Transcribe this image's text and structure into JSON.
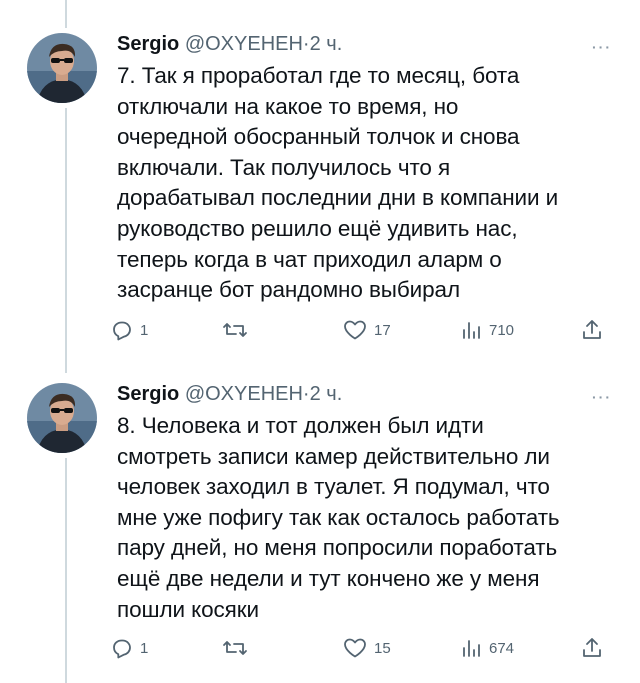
{
  "tweets": [
    {
      "author_name": "Sergio",
      "author_handle": "@OXYEHEH",
      "separator": "·",
      "time": "2 ч.",
      "more_glyph": "···",
      "text": "7. Так я проработал где то месяц, бота\nотключали на какое то время, но\nочередной обосранный толчок и снова\nвключали. Так получилось что я\nдорабатывал последнии дни в компании и\nруководство решило ещё удивить нас,\nтеперь когда в чат приходил аларм о\nзасранце бот рандомно выбирал",
      "replies": "1",
      "retweets": "",
      "likes": "17",
      "views": "710"
    },
    {
      "author_name": "Sergio",
      "author_handle": "@OXYEHEH",
      "separator": "·",
      "time": "2 ч.",
      "more_glyph": "···",
      "text": "8. Человека и тот должен был идти\nсмотреть записи камер действительно ли\nчеловек заходил в туалет. Я подумал, что\nмне уже пофигу так как осталось работать\nпару дней, но меня попросили поработать\nещё две недели и тут кончено же у меня\nпошли косяки",
      "replies": "1",
      "retweets": "",
      "likes": "15",
      "views": "674"
    }
  ],
  "icons": {
    "reply": "reply-icon",
    "retweet": "retweet-icon",
    "like": "heart-icon",
    "views": "views-icon",
    "share": "share-icon"
  },
  "colors": {
    "text": "#0f1419",
    "secondary": "#536471",
    "thread_line": "#cfd9de"
  }
}
